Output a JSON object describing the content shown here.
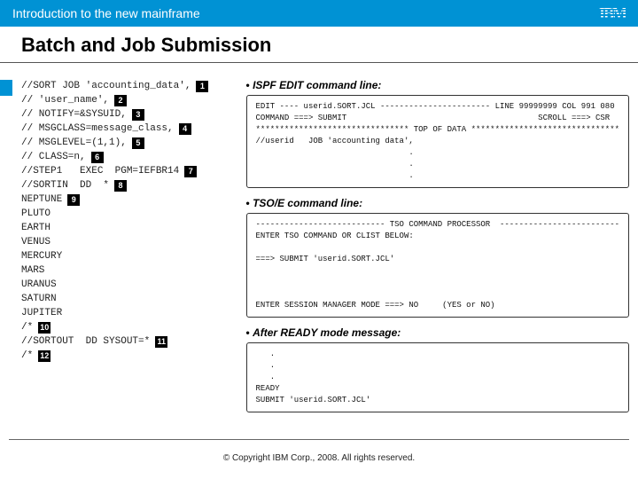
{
  "header": {
    "subtitle": "Introduction to the new mainframe",
    "logo": "IBM"
  },
  "title": "Batch and Job Submission",
  "code_lines": [
    {
      "t": "//SORT JOB 'accounting_data',",
      "n": "1"
    },
    {
      "t": "// 'user_name',",
      "n": "2"
    },
    {
      "t": "// NOTIFY=&SYSUID,",
      "n": "3"
    },
    {
      "t": "// MSGCLASS=message_class,",
      "n": "4"
    },
    {
      "t": "// MSGLEVEL=(1,1),",
      "n": "5"
    },
    {
      "t": "// CLASS=n,",
      "n": "6"
    },
    {
      "t": "//STEP1   EXEC  PGM=IEFBR14",
      "n": "7"
    },
    {
      "t": "//SORTIN  DD  *",
      "n": "8"
    },
    {
      "t": "NEPTUNE",
      "n": "9"
    },
    {
      "t": "PLUTO",
      "n": ""
    },
    {
      "t": "EARTH",
      "n": ""
    },
    {
      "t": "VENUS",
      "n": ""
    },
    {
      "t": "MERCURY",
      "n": ""
    },
    {
      "t": "MARS",
      "n": ""
    },
    {
      "t": "URANUS",
      "n": ""
    },
    {
      "t": "SATURN",
      "n": ""
    },
    {
      "t": "JUPITER",
      "n": ""
    },
    {
      "t": "/*",
      "n": "10"
    },
    {
      "t": "//SORTOUT  DD SYSOUT=*",
      "n": "11"
    },
    {
      "t": "/*",
      "n": "12"
    }
  ],
  "sections": [
    {
      "head": "ISPF EDIT command line:",
      "panel": "EDIT ---- userid.SORT.JCL ----------------------- LINE 99999999 COL 991 080\nCOMMAND ===> SUBMIT                                        SCROLL ===> CSR\n******************************** TOP OF DATA *******************************\n//userid   JOB 'accounting data',\n                                .\n                                .\n                                ."
    },
    {
      "head": "TSO/E command line:",
      "panel": "--------------------------- TSO COMMAND PROCESSOR  -------------------------\nENTER TSO COMMAND OR CLIST BELOW:\n\n===> SUBMIT 'userid.SORT.JCL'\n\n\n\nENTER SESSION MANAGER MODE ===> NO     (YES or NO)"
    },
    {
      "head": "After READY mode message:",
      "panel": "   .\n   .\n   .\nREADY\nSUBMIT 'userid.SORT.JCL'"
    }
  ],
  "footer": "© Copyright IBM Corp., 2008. All rights reserved."
}
